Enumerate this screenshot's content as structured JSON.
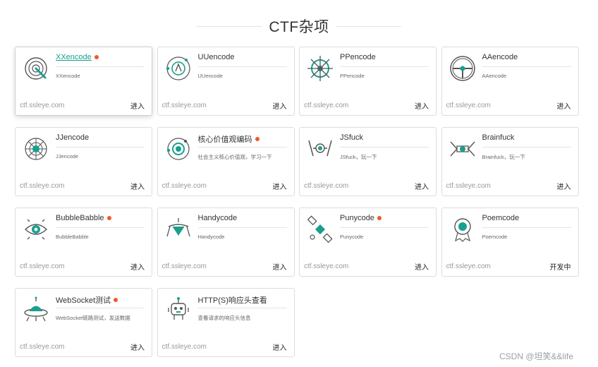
{
  "section": {
    "title": "CTF杂项"
  },
  "colors": {
    "accent": "#1a9f8e",
    "dot": "#f0592a",
    "border": "#dcdcdc"
  },
  "cards": [
    {
      "name": "XXencode",
      "desc": "XXencode",
      "site": "ctf.ssleye.com",
      "action": "进入",
      "new": true,
      "active": true,
      "icon": "spiral-icon"
    },
    {
      "name": "UUencode",
      "desc": "UUencode",
      "site": "ctf.ssleye.com",
      "action": "进入",
      "new": false,
      "active": false,
      "icon": "orbit-icon"
    },
    {
      "name": "PPencode",
      "desc": "PPencode",
      "site": "ctf.ssleye.com",
      "action": "进入",
      "new": false,
      "active": false,
      "icon": "ship-wheel-icon"
    },
    {
      "name": "AAencode",
      "desc": "AAencode",
      "site": "ctf.ssleye.com",
      "action": "进入",
      "new": false,
      "active": false,
      "icon": "steering-wheel-icon"
    },
    {
      "name": "JJencode",
      "desc": "JJencode",
      "site": "ctf.ssleye.com",
      "action": "进入",
      "new": false,
      "active": false,
      "icon": "web-icon"
    },
    {
      "name": "核心价值观编码",
      "desc": "社会主义核心价值观，学习一下",
      "site": "ctf.ssleye.com",
      "action": "进入",
      "new": true,
      "active": false,
      "icon": "planet-icon"
    },
    {
      "name": "JSfuck",
      "desc": "JSfuck，玩一下",
      "site": "ctf.ssleye.com",
      "action": "进入",
      "new": false,
      "active": false,
      "icon": "tie-fighter-icon"
    },
    {
      "name": "Brainfuck",
      "desc": "Brainfuck，玩一下",
      "site": "ctf.ssleye.com",
      "action": "进入",
      "new": false,
      "active": false,
      "icon": "fighter-icon"
    },
    {
      "name": "BubbleBabble",
      "desc": "BubbleBabble",
      "site": "ctf.ssleye.com",
      "action": "进入",
      "new": true,
      "active": false,
      "icon": "eye-icon"
    },
    {
      "name": "Handycode",
      "desc": "Handycode",
      "site": "ctf.ssleye.com",
      "action": "进入",
      "new": false,
      "active": false,
      "icon": "lander-icon"
    },
    {
      "name": "Punycode",
      "desc": "Punycode",
      "site": "ctf.ssleye.com",
      "action": "进入",
      "new": true,
      "active": false,
      "icon": "satellite-icon"
    },
    {
      "name": "Poemcode",
      "desc": "Poemcode",
      "site": "ctf.ssleye.com",
      "action": "开发中",
      "new": false,
      "active": false,
      "icon": "badge-icon"
    },
    {
      "name": "WebSocket测试",
      "desc": "WebSocket链路测试，发送数据",
      "site": "ctf.ssleye.com",
      "action": "进入",
      "new": true,
      "active": false,
      "icon": "ufo-icon"
    },
    {
      "name": "HTTP(S)响应头查看",
      "desc": "查看请求的响应头信息",
      "site": "ctf.ssleye.com",
      "action": "进入",
      "new": false,
      "active": false,
      "icon": "robot-icon"
    }
  ],
  "watermark": "CSDN @坦笑&&life"
}
